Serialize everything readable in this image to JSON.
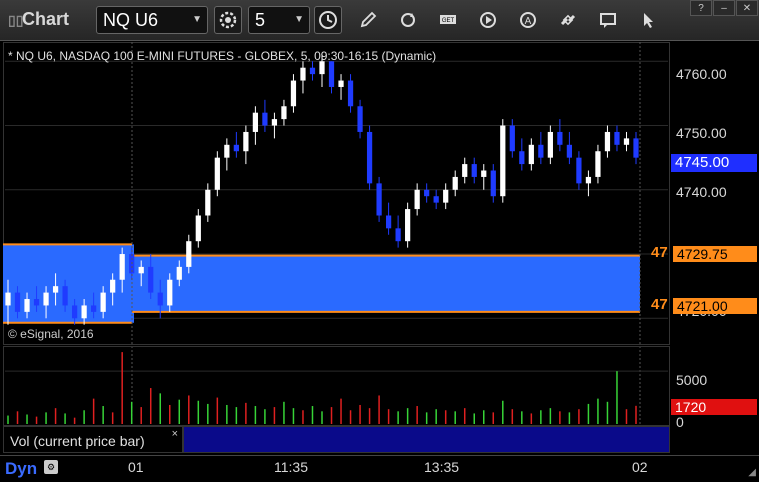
{
  "app": {
    "title": "Chart"
  },
  "toolbar": {
    "symbol": "NQ U6",
    "interval": "5"
  },
  "chart": {
    "info": "* NQ U6, NASDAQ 100 E-MINI FUTURES - GLOBEX, 5, 09:30-16:15 (Dynamic)",
    "copyright": "© eSignal, 2016",
    "price_labels": [
      "4760.00",
      "4750.00",
      "4740.00",
      "4720.00"
    ],
    "current_price": "4745.00",
    "range_high_tag": "4729.75",
    "range_low_tag": "4721.00",
    "cut_high": "47",
    "cut_low": "47"
  },
  "volume": {
    "legend": "Vol (current price bar)",
    "legend_close": "×",
    "label_5000": "5000",
    "label_0": "0",
    "current_vol": "1720"
  },
  "footer": {
    "mode": "Dyn",
    "time_labels": [
      "01",
      "11:35",
      "13:35",
      "02"
    ]
  },
  "colors": {
    "up": "#ffffff",
    "down": "#1f3bff",
    "range": "#2a6aff",
    "orange": "#ff8c1a",
    "vol_up": "#37d437",
    "vol_down": "#e02020"
  },
  "chart_data": {
    "type": "candlestick",
    "ylim": [
      4716,
      4763
    ],
    "range_box": {
      "high": 4729.75,
      "low": 4721.0
    },
    "bars": [
      [
        4722,
        4726,
        4719,
        4724
      ],
      [
        4724,
        4725,
        4720,
        4721
      ],
      [
        4721,
        4724,
        4720,
        4723
      ],
      [
        4723,
        4725,
        4721,
        4722
      ],
      [
        4722,
        4725,
        4720,
        4724
      ],
      [
        4724,
        4727,
        4722,
        4725
      ],
      [
        4725,
        4726,
        4721,
        4722
      ],
      [
        4722,
        4723,
        4719,
        4720
      ],
      [
        4720,
        4723,
        4719,
        4722
      ],
      [
        4722,
        4724,
        4720,
        4721
      ],
      [
        4721,
        4725,
        4720,
        4724
      ],
      [
        4724,
        4727,
        4722,
        4726
      ],
      [
        4726,
        4731,
        4724,
        4730
      ],
      [
        4730,
        4731,
        4726,
        4727
      ],
      [
        4727,
        4729,
        4725,
        4728
      ],
      [
        4728,
        4730,
        4723,
        4724
      ],
      [
        4724,
        4726,
        4720,
        4722
      ],
      [
        4722,
        4727,
        4721,
        4726
      ],
      [
        4726,
        4729,
        4725,
        4728
      ],
      [
        4728,
        4733,
        4727,
        4732
      ],
      [
        4732,
        4737,
        4731,
        4736
      ],
      [
        4736,
        4741,
        4735,
        4740
      ],
      [
        4740,
        4746,
        4739,
        4745
      ],
      [
        4745,
        4748,
        4743,
        4747
      ],
      [
        4747,
        4749,
        4745,
        4746
      ],
      [
        4746,
        4750,
        4744,
        4749
      ],
      [
        4749,
        4753,
        4747,
        4752
      ],
      [
        4752,
        4754,
        4749,
        4750
      ],
      [
        4750,
        4752,
        4748,
        4751
      ],
      [
        4751,
        4754,
        4750,
        4753
      ],
      [
        4753,
        4758,
        4752,
        4757
      ],
      [
        4757,
        4760,
        4755,
        4759
      ],
      [
        4759,
        4760,
        4757,
        4758
      ],
      [
        4758,
        4761,
        4756,
        4760
      ],
      [
        4760,
        4760,
        4755,
        4756
      ],
      [
        4756,
        4758,
        4754,
        4757
      ],
      [
        4757,
        4758,
        4752,
        4753
      ],
      [
        4753,
        4754,
        4748,
        4749
      ],
      [
        4749,
        4750,
        4740,
        4741
      ],
      [
        4741,
        4742,
        4735,
        4736
      ],
      [
        4736,
        4738,
        4733,
        4734
      ],
      [
        4734,
        4736,
        4731,
        4732
      ],
      [
        4732,
        4738,
        4731,
        4737
      ],
      [
        4737,
        4741,
        4736,
        4740
      ],
      [
        4740,
        4741,
        4738,
        4739
      ],
      [
        4739,
        4740,
        4737,
        4738
      ],
      [
        4738,
        4741,
        4737,
        4740
      ],
      [
        4740,
        4743,
        4739,
        4742
      ],
      [
        4742,
        4745,
        4741,
        4744
      ],
      [
        4744,
        4745,
        4741,
        4742
      ],
      [
        4742,
        4744,
        4740,
        4743
      ],
      [
        4743,
        4744,
        4738,
        4739
      ],
      [
        4739,
        4751,
        4738,
        4750
      ],
      [
        4750,
        4751,
        4745,
        4746
      ],
      [
        4746,
        4748,
        4743,
        4744
      ],
      [
        4744,
        4748,
        4743,
        4747
      ],
      [
        4747,
        4749,
        4744,
        4745
      ],
      [
        4745,
        4750,
        4744,
        4749
      ],
      [
        4749,
        4751,
        4746,
        4747
      ],
      [
        4747,
        4749,
        4744,
        4745
      ],
      [
        4745,
        4746,
        4740,
        4741
      ],
      [
        4741,
        4743,
        4739,
        4742
      ],
      [
        4742,
        4747,
        4741,
        4746
      ],
      [
        4746,
        4750,
        4745,
        4749
      ],
      [
        4749,
        4750,
        4746,
        4747
      ],
      [
        4747,
        4749,
        4746,
        4748
      ],
      [
        4748,
        4749,
        4744,
        4745
      ]
    ],
    "volume": [
      [
        800,
        1
      ],
      [
        1200,
        0
      ],
      [
        900,
        1
      ],
      [
        700,
        0
      ],
      [
        1100,
        1
      ],
      [
        1500,
        0
      ],
      [
        1000,
        1
      ],
      [
        600,
        0
      ],
      [
        1300,
        1
      ],
      [
        2400,
        0
      ],
      [
        1700,
        1
      ],
      [
        1100,
        0
      ],
      [
        6800,
        0
      ],
      [
        2100,
        1
      ],
      [
        1600,
        0
      ],
      [
        3400,
        0
      ],
      [
        2900,
        1
      ],
      [
        1800,
        0
      ],
      [
        2300,
        1
      ],
      [
        2700,
        0
      ],
      [
        2200,
        1
      ],
      [
        1900,
        1
      ],
      [
        2500,
        0
      ],
      [
        1800,
        1
      ],
      [
        1600,
        1
      ],
      [
        2000,
        0
      ],
      [
        1700,
        1
      ],
      [
        1400,
        1
      ],
      [
        1600,
        0
      ],
      [
        2100,
        1
      ],
      [
        1500,
        1
      ],
      [
        1300,
        0
      ],
      [
        1700,
        1
      ],
      [
        1200,
        1
      ],
      [
        1600,
        0
      ],
      [
        2400,
        0
      ],
      [
        1300,
        0
      ],
      [
        1800,
        0
      ],
      [
        1500,
        0
      ],
      [
        2700,
        0
      ],
      [
        1400,
        0
      ],
      [
        1200,
        1
      ],
      [
        1500,
        1
      ],
      [
        1700,
        0
      ],
      [
        1100,
        1
      ],
      [
        1400,
        1
      ],
      [
        1300,
        0
      ],
      [
        1200,
        1
      ],
      [
        1500,
        0
      ],
      [
        1000,
        1
      ],
      [
        1300,
        1
      ],
      [
        1100,
        0
      ],
      [
        2200,
        1
      ],
      [
        1400,
        0
      ],
      [
        1200,
        1
      ],
      [
        1000,
        0
      ],
      [
        1300,
        1
      ],
      [
        1500,
        1
      ],
      [
        1200,
        0
      ],
      [
        1100,
        1
      ],
      [
        1400,
        0
      ],
      [
        1900,
        1
      ],
      [
        2400,
        1
      ],
      [
        2100,
        1
      ],
      [
        5000,
        1
      ],
      [
        1400,
        0
      ],
      [
        1720,
        0
      ]
    ]
  }
}
